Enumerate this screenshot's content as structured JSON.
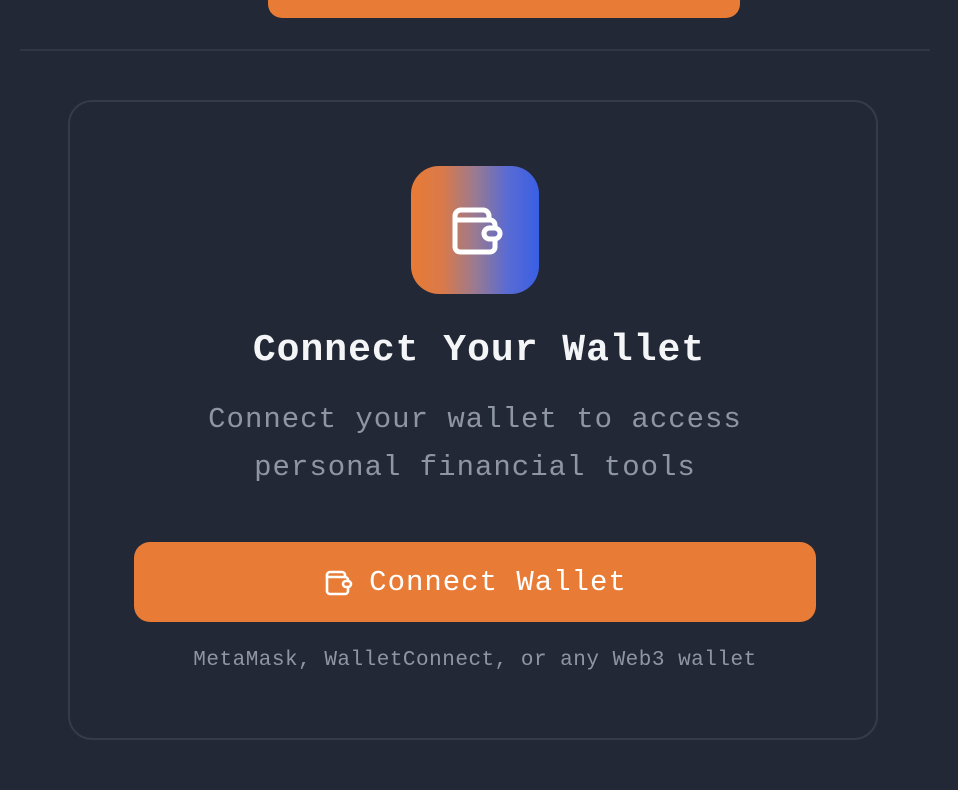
{
  "card": {
    "title": "Connect Your Wallet",
    "subtitle": "Connect your wallet to access personal financial tools",
    "connect_button_label": "Connect Wallet",
    "hint": "MetaMask, WalletConnect, or any Web3 wallet",
    "icon": "wallet-icon"
  },
  "colors": {
    "background": "#222836",
    "accent": "#E87B35",
    "gradient_start": "#E87B35",
    "gradient_end": "#3A5FE5",
    "muted_text": "#8F96A3",
    "title_text": "#F4F5F7"
  }
}
